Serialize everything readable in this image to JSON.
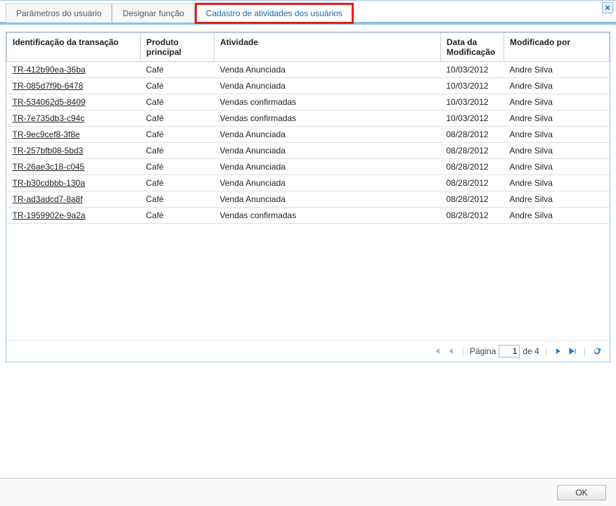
{
  "window": {
    "close_symbol": "✕"
  },
  "tabs": [
    {
      "label": "Parâmetros do usuário"
    },
    {
      "label": "Designar função"
    },
    {
      "label": "Cadastro de atividades dos usuários"
    }
  ],
  "table": {
    "headers": {
      "id": "Identificação da transação",
      "product": "Produto principal",
      "activity": "Atividade",
      "mod_date": "Data da Modificação",
      "mod_by": "Modificado por"
    },
    "rows": [
      {
        "id": "TR-412b90ea-36ba",
        "product": "Café",
        "activity": "Venda Anunciada",
        "mod_date": "10/03/2012",
        "mod_by": "Andre Silva"
      },
      {
        "id": "TR-085d7f9b-6478",
        "product": "Café",
        "activity": "Venda Anunciada",
        "mod_date": "10/03/2012",
        "mod_by": "Andre Silva"
      },
      {
        "id": "TR-534062d5-8409",
        "product": "Café",
        "activity": "Vendas confirmadas",
        "mod_date": "10/03/2012",
        "mod_by": "Andre Silva"
      },
      {
        "id": "TR-7e735db3-c94c",
        "product": "Café",
        "activity": "Vendas confirmadas",
        "mod_date": "10/03/2012",
        "mod_by": "Andre Silva"
      },
      {
        "id": "TR-9ec9cef8-3f8e",
        "product": "Café",
        "activity": "Venda Anunciada",
        "mod_date": "08/28/2012",
        "mod_by": "Andre Silva"
      },
      {
        "id": "TR-257bfb08-5bd3",
        "product": "Café",
        "activity": "Venda Anunciada",
        "mod_date": "08/28/2012",
        "mod_by": "Andre Silva"
      },
      {
        "id": "TR-26ae3c18-c045",
        "product": "Café",
        "activity": "Venda Anunciada",
        "mod_date": "08/28/2012",
        "mod_by": "Andre Silva"
      },
      {
        "id": "TR-b30cdbbb-130a",
        "product": "Café",
        "activity": "Venda Anunciada",
        "mod_date": "08/28/2012",
        "mod_by": "Andre Silva"
      },
      {
        "id": "TR-ad3adcd7-8a8f",
        "product": "Café",
        "activity": "Venda Anunciada",
        "mod_date": "08/28/2012",
        "mod_by": "Andre Silva"
      },
      {
        "id": "TR-1959902e-9a2a",
        "product": "Café",
        "activity": "Vendas confirmadas",
        "mod_date": "08/28/2012",
        "mod_by": "Andre Silva"
      }
    ]
  },
  "pager": {
    "page_label": "Página",
    "current_page": "1",
    "of_label": "de 4"
  },
  "footer": {
    "ok_label": "OK"
  }
}
